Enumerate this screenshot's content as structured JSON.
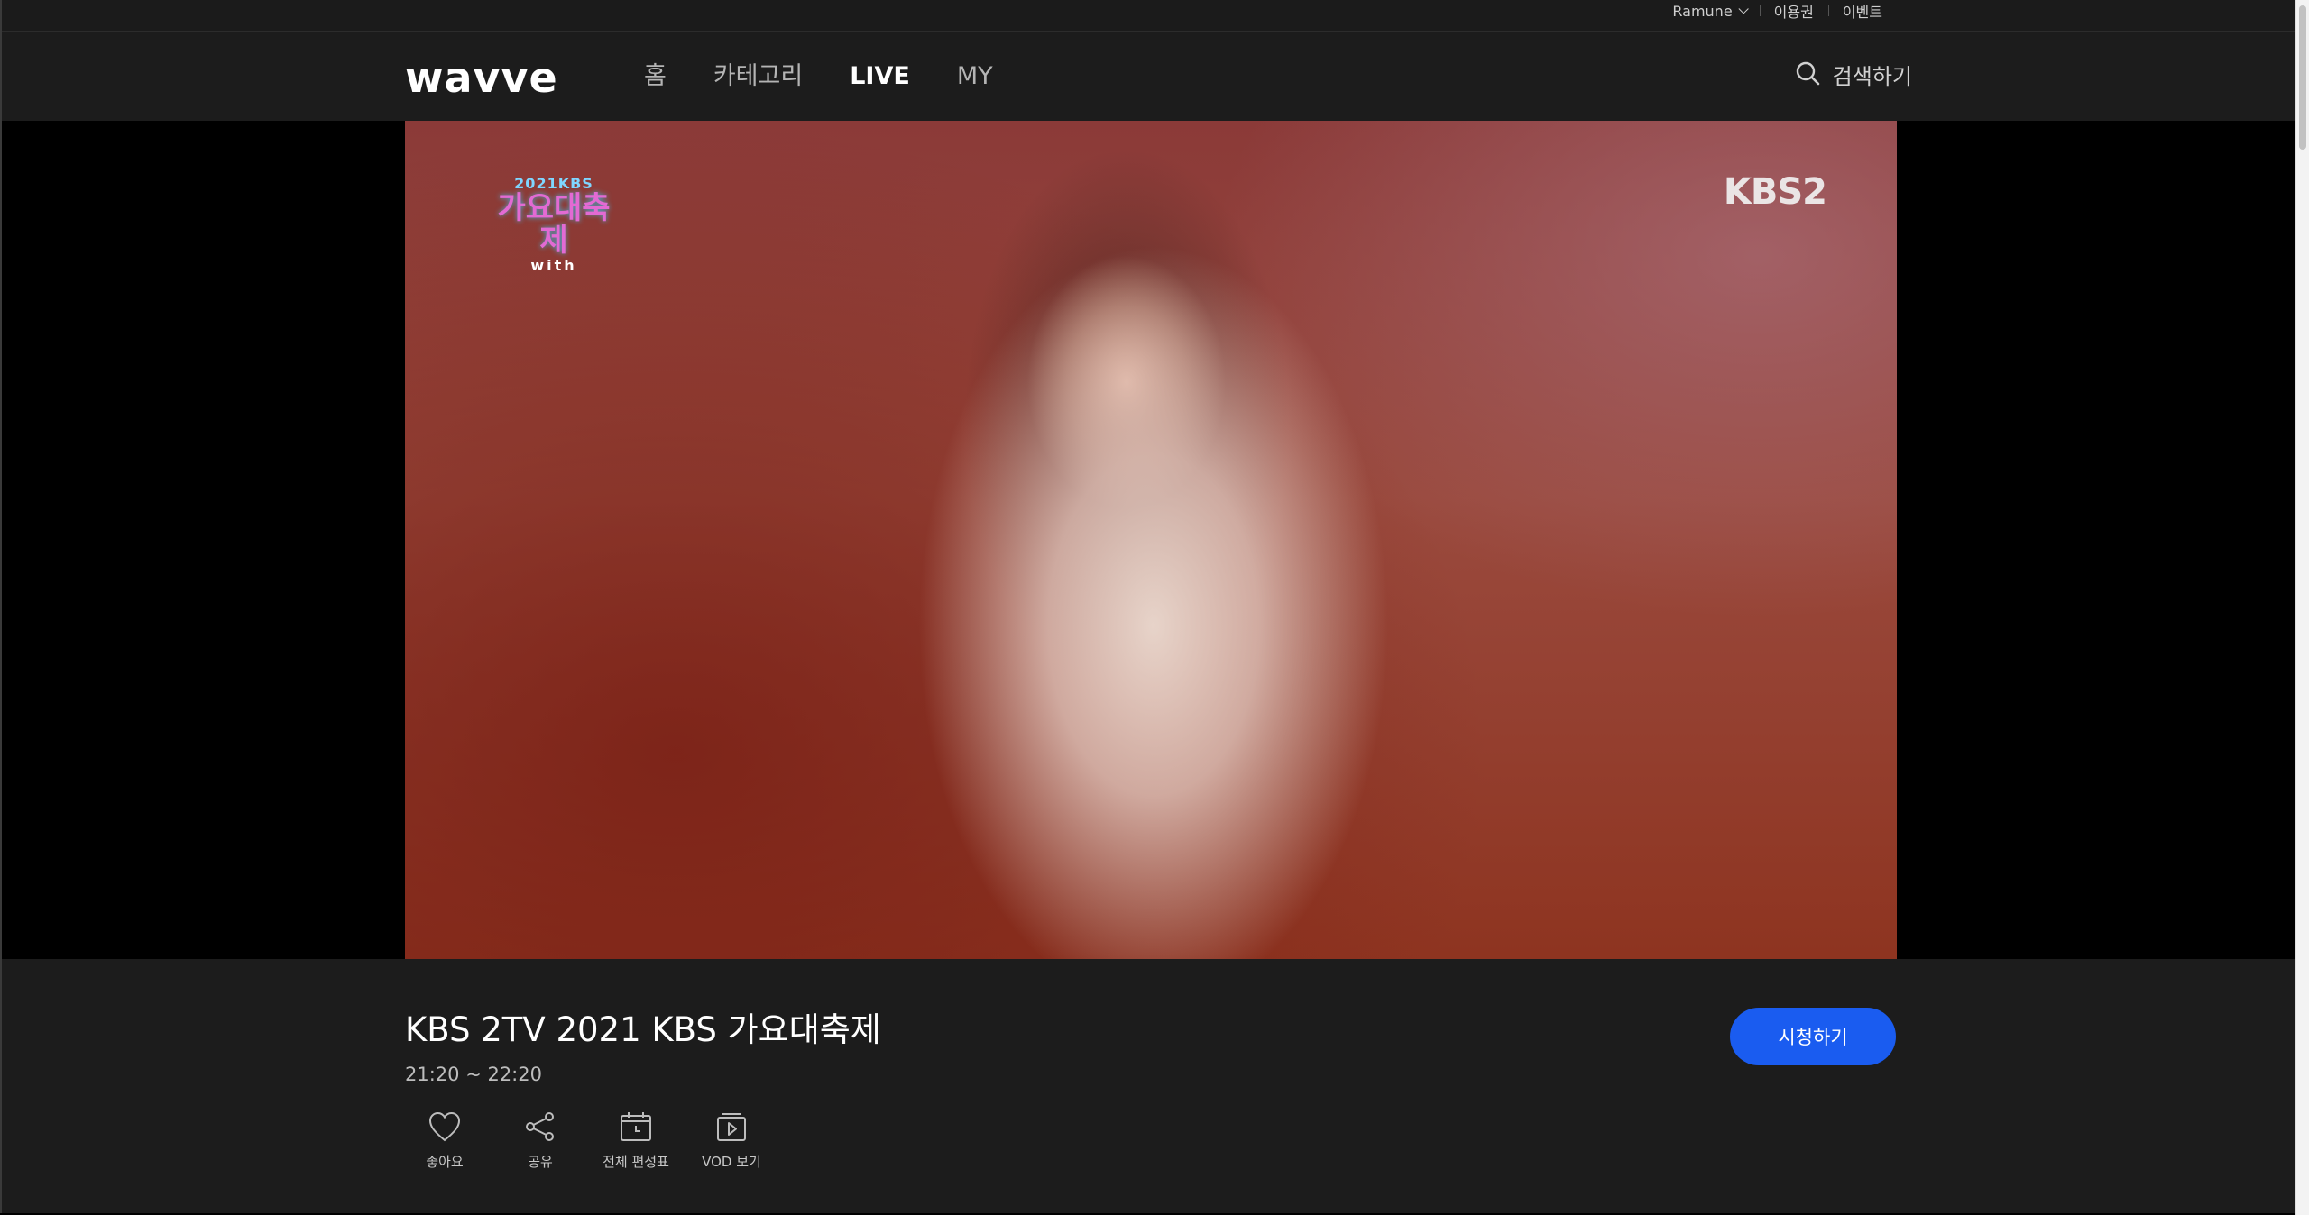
{
  "util_bar": {
    "profile_label": "Ramune",
    "pass_label": "이용권",
    "event_label": "이벤트"
  },
  "header": {
    "logo_text": "wavve",
    "nav": [
      {
        "label": "홈",
        "active": false
      },
      {
        "label": "카테고리",
        "active": false
      },
      {
        "label": "LIVE",
        "active": true
      },
      {
        "label": "MY",
        "active": false
      }
    ],
    "search_label": "검색하기"
  },
  "player": {
    "badge_year": "2021KBS",
    "badge_title": "가요대축제",
    "badge_sub": "with",
    "channel_logo": "KBS2"
  },
  "program": {
    "title": "KBS 2TV 2021 KBS 가요대축제",
    "time": "21:20 ~ 22:20",
    "watch_label": "시청하기"
  },
  "actions": [
    {
      "label": "좋아요",
      "icon": "heart-icon"
    },
    {
      "label": "공유",
      "icon": "share-icon"
    },
    {
      "label": "전체 편성표",
      "icon": "calendar-icon"
    },
    {
      "label": "VOD 보기",
      "icon": "vod-play-icon"
    }
  ],
  "colors": {
    "background": "#1c1c1c",
    "accent": "#1a5cf0",
    "text": "#ffffff"
  }
}
